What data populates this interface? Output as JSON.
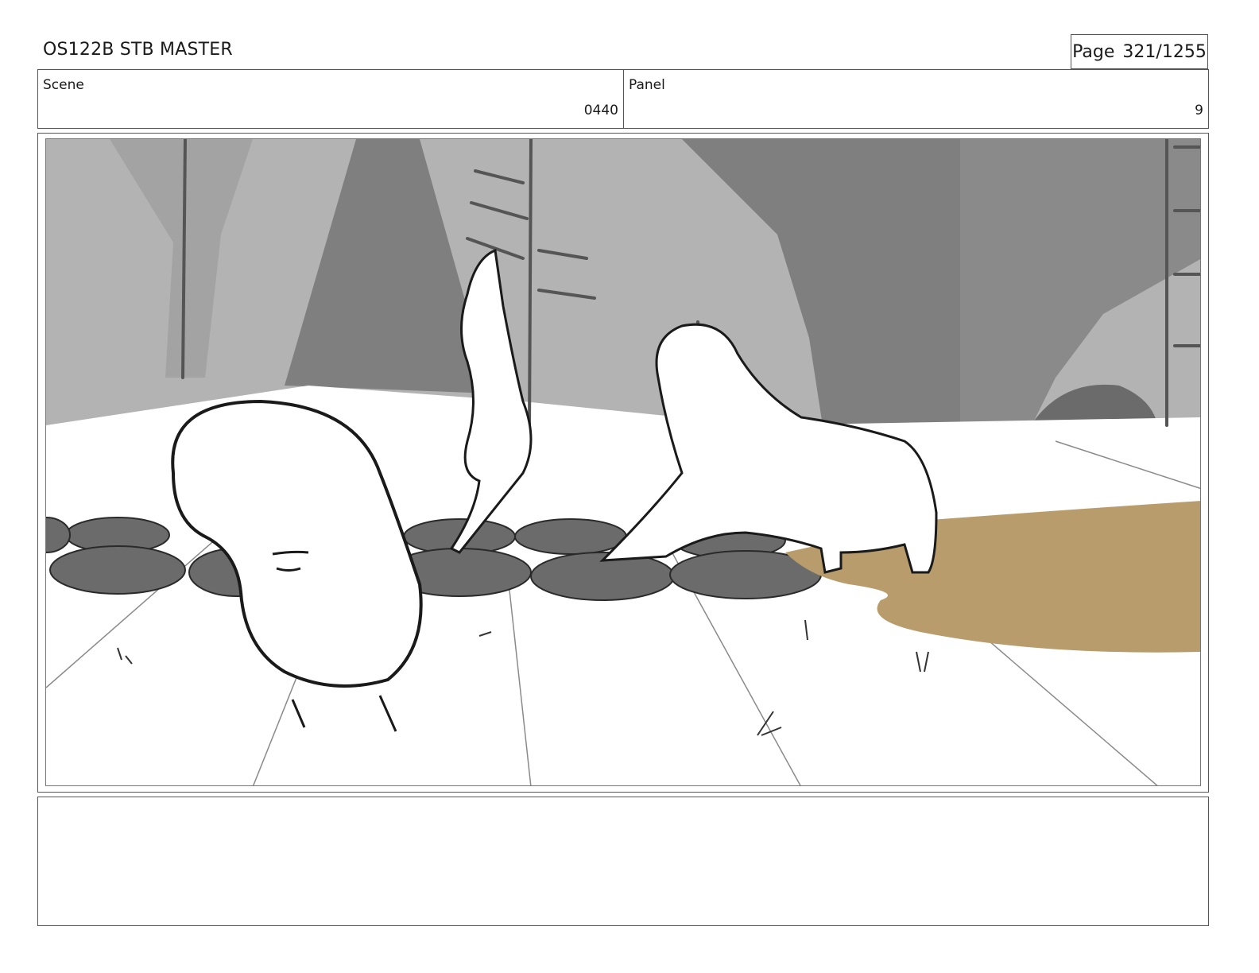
{
  "header": {
    "title": "OS122B STB MASTER",
    "page_label": "Page",
    "page_number": "321/1255"
  },
  "info": {
    "scene_label": "Scene",
    "scene_value": "0440",
    "panel_label": "Panel",
    "panel_value": "9"
  },
  "drawing": {
    "colors": {
      "sky_gray": "#b3b3b3",
      "mid_gray": "#7f7f7f",
      "dark_gray": "#6b6b6b",
      "ground": "#ffffff",
      "puddle": "#b89c6c",
      "ink": "#1a1a1a"
    }
  },
  "notes": {
    "text": ""
  }
}
